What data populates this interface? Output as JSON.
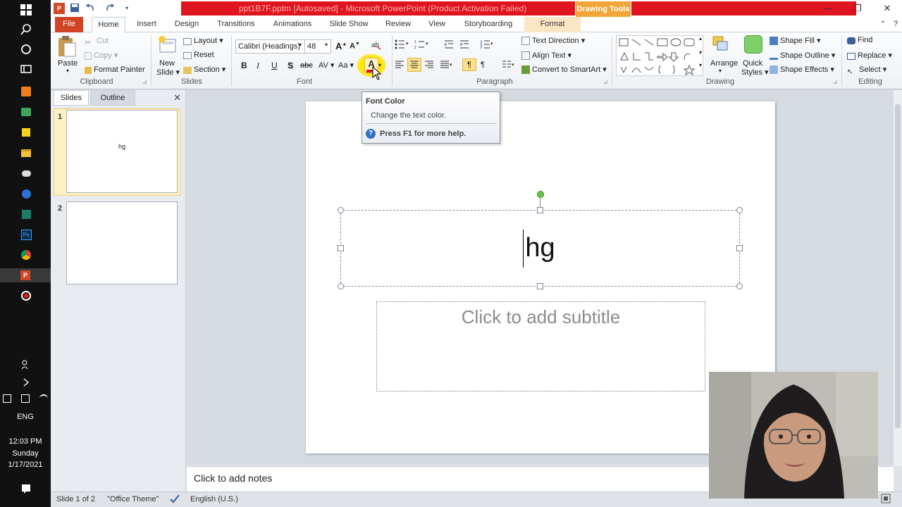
{
  "taskbar": {
    "icons": [
      "windows-start-icon",
      "search-icon",
      "cortana-icon",
      "task-view-icon",
      "app-orange-icon",
      "app-green-icon",
      "sticky-notes-icon",
      "file-explorer-icon",
      "app-cloud-icon",
      "app-globe-icon",
      "app-terminal-icon",
      "photoshop-icon",
      "chrome-icon",
      "powerpoint-icon",
      "record-icon"
    ],
    "photoshop_label": "Ps",
    "powerpoint_label": "P",
    "lang": "ENG",
    "time": "12:03 PM",
    "day": "Sunday",
    "date": "1/17/2021"
  },
  "window": {
    "title": "ppt1B7F.pptm [Autosaved]  -  Microsoft PowerPoint (Product Activation Failed)",
    "drawing_tools": "Drawing Tools"
  },
  "tabs": [
    "File",
    "Home",
    "Insert",
    "Design",
    "Transitions",
    "Animations",
    "Slide Show",
    "Review",
    "View",
    "Storyboarding",
    "Format"
  ],
  "ribbon": {
    "clipboard": {
      "paste": "Paste",
      "cut": "Cut",
      "copy": "Copy",
      "format_painter": "Format Painter",
      "label": "Clipboard"
    },
    "slides": {
      "new_slide_1": "New",
      "new_slide_2": "Slide",
      "layout": "Layout",
      "reset": "Reset",
      "section": "Section",
      "label": "Slides"
    },
    "font": {
      "family": "Calibri (Headings)",
      "size": "48",
      "label": "Font",
      "bold": "B",
      "italic": "I",
      "underline": "U",
      "shadow": "S",
      "strike": "abc",
      "spacing": "AV",
      "case": "Aa",
      "font_color": "A",
      "grow": "A",
      "shrink": "A"
    },
    "paragraph": {
      "label": "Paragraph",
      "text_direction": "Text Direction",
      "align_text": "Align Text",
      "smartart": "Convert to SmartArt"
    },
    "drawing": {
      "label": "Drawing",
      "arrange": "Arrange",
      "quick_styles_1": "Quick",
      "quick_styles_2": "Styles",
      "shape_fill": "Shape Fill",
      "shape_outline": "Shape Outline",
      "shape_effects": "Shape Effects"
    },
    "editing": {
      "label": "Editing",
      "find": "Find",
      "replace": "Replace",
      "select": "Select"
    }
  },
  "tooltip": {
    "title": "Font Color",
    "body": "Change the text color.",
    "help": "Press F1 for more help."
  },
  "pane": {
    "tab_slides": "Slides",
    "tab_outline": "Outline",
    "thumb1_num": "1",
    "thumb1_text": "hg",
    "thumb2_num": "2"
  },
  "slide": {
    "title": "hg",
    "subtitle_placeholder": "Click to add subtitle"
  },
  "notes_placeholder": "Click to add notes",
  "statusbar": {
    "slide_count": "Slide 1 of 2",
    "theme": "\"Office Theme\"",
    "language": "English (U.S.)"
  },
  "colors": {
    "file_tab": "#d04423",
    "title_red": "#e0141e",
    "drawing_tools": "#f2a63a",
    "font_color_red": "#e0141e"
  }
}
